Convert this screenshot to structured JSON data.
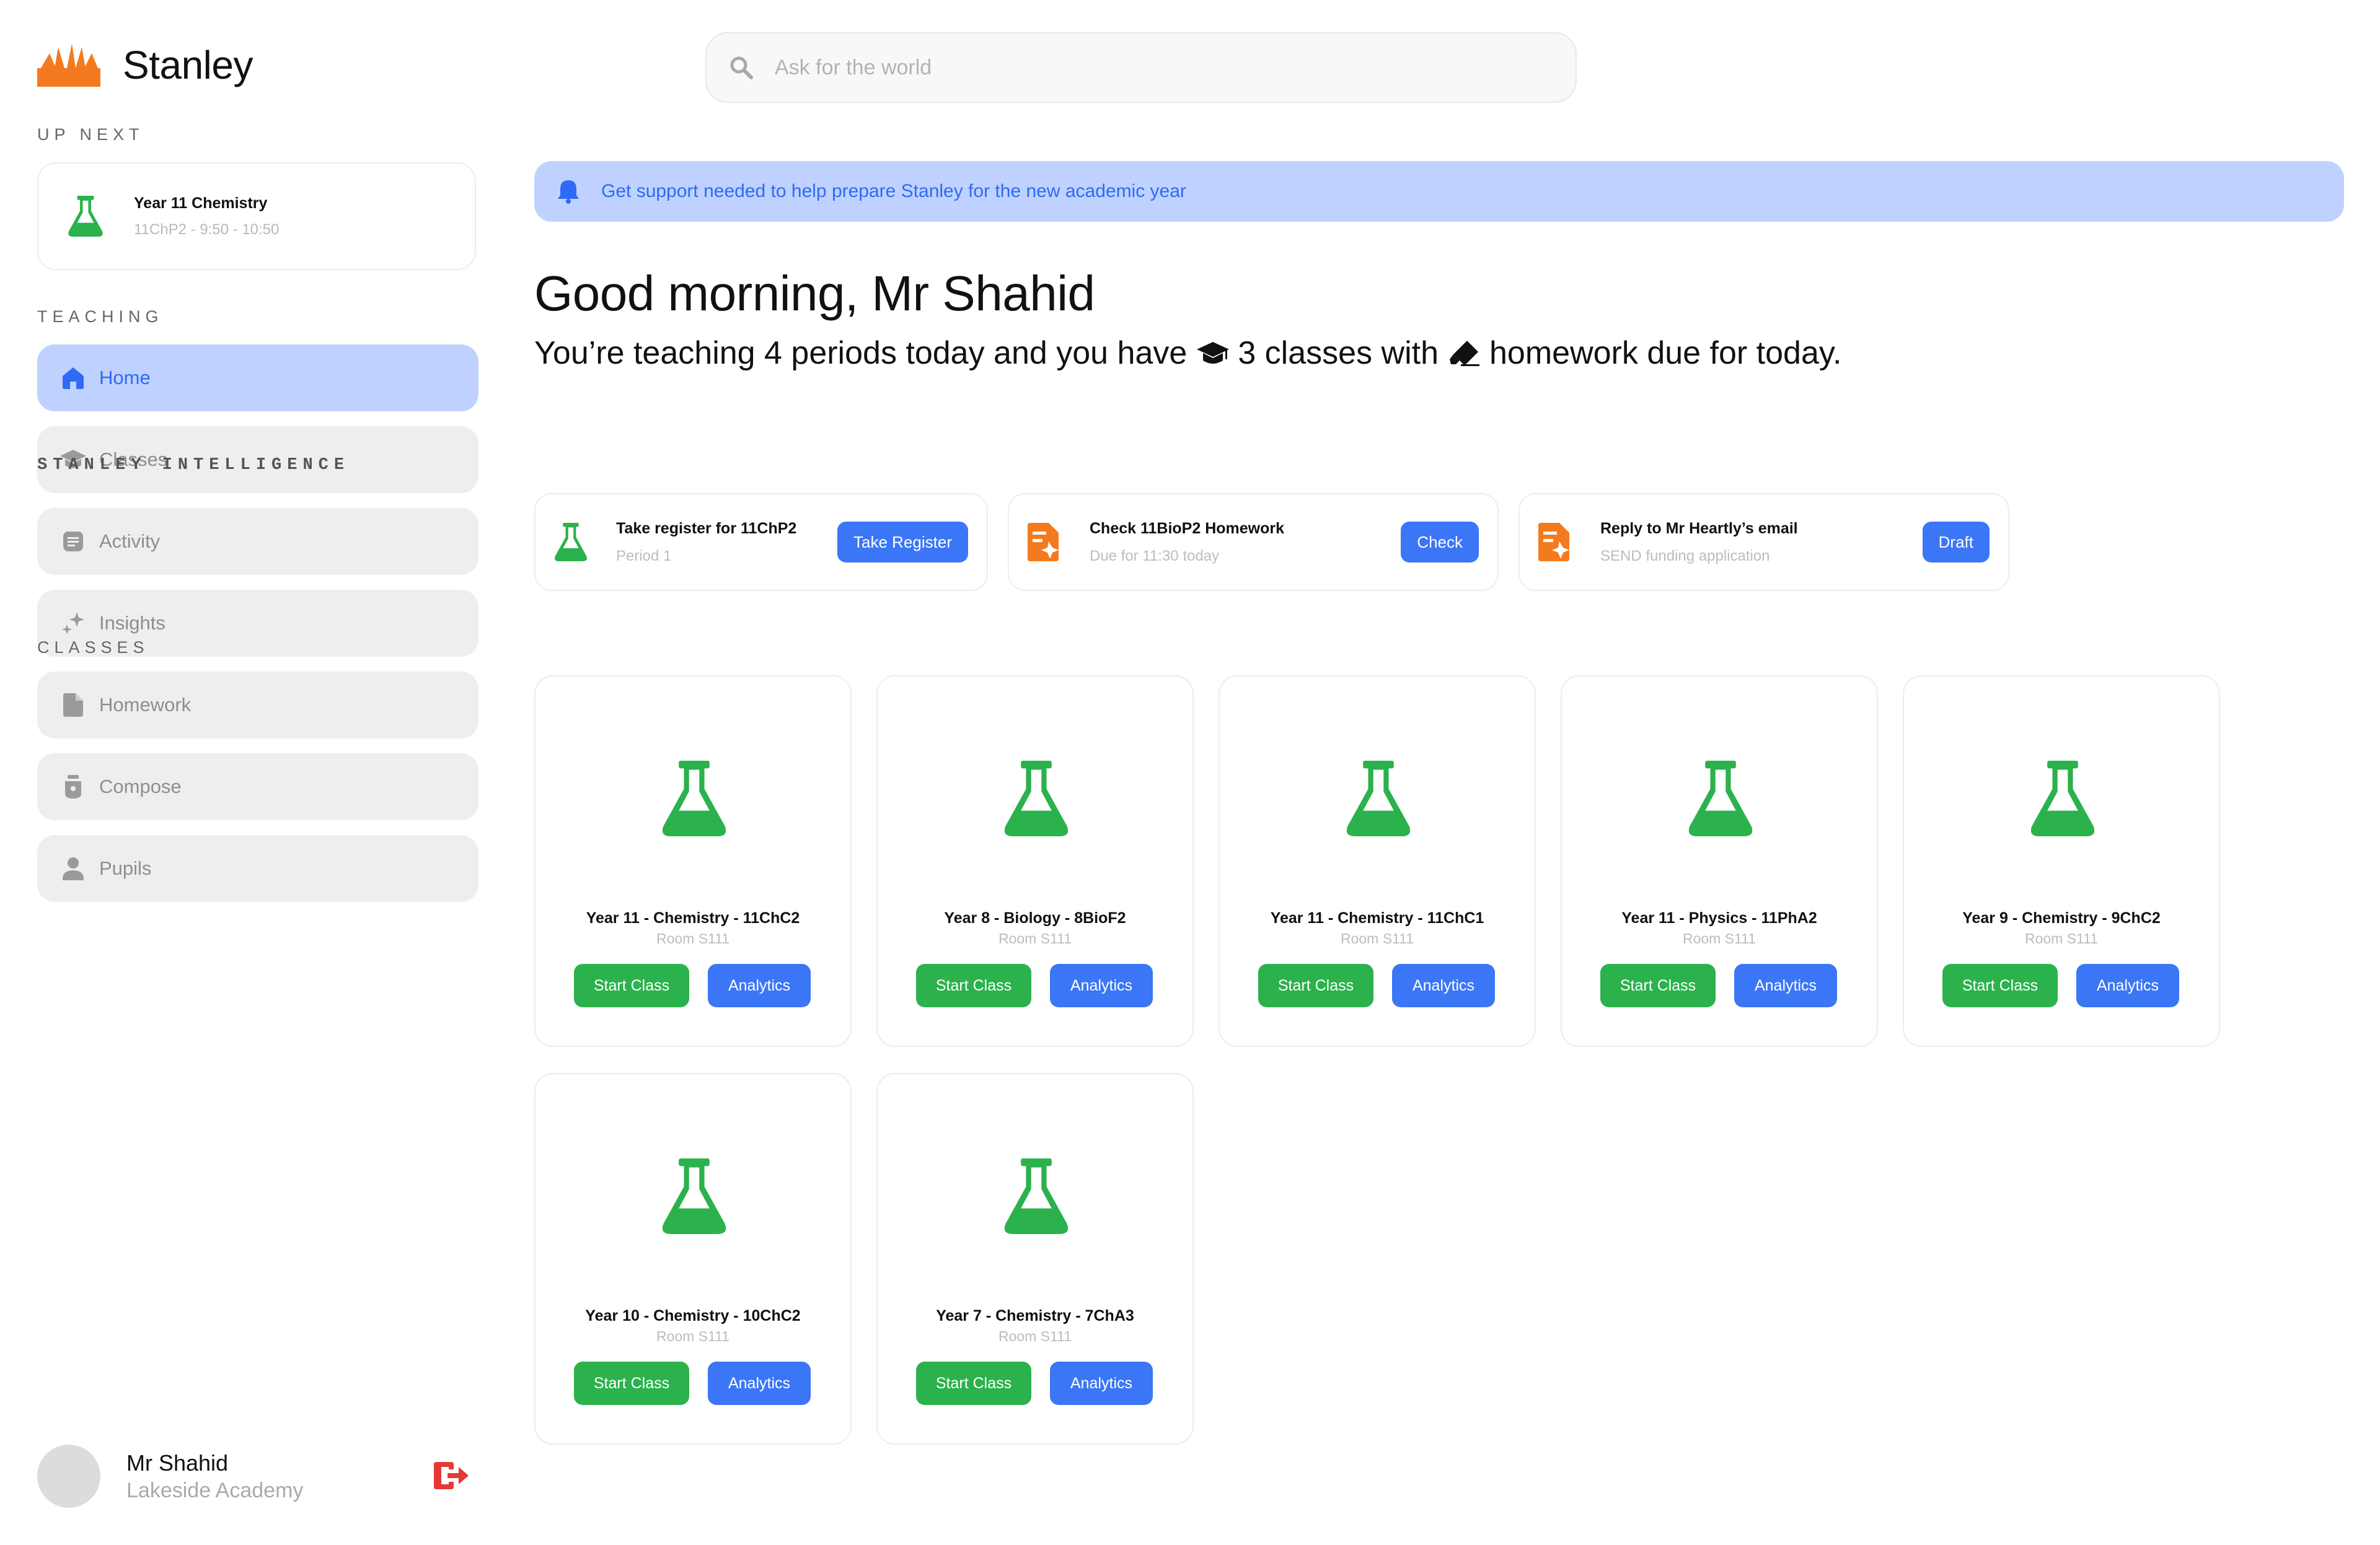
{
  "app": {
    "name": "Stanley"
  },
  "colors": {
    "accent": "#2f6af5",
    "active_bg": "#bfd2ff",
    "green": "#2bb24c",
    "orange": "#f47a1f",
    "red": "#e53935"
  },
  "up_next": {
    "label": "UP NEXT",
    "title": "Year 11 Chemistry",
    "detail": "11ChP2 - 9:50 - 10:50",
    "icon": "flask-icon"
  },
  "sidebar": {
    "section_label": "TEACHING",
    "items": [
      {
        "label": "Home",
        "icon": "home-icon",
        "active": true
      },
      {
        "label": "Classes",
        "icon": "graduation-cap-icon",
        "active": false
      },
      {
        "label": "Activity",
        "icon": "list-icon",
        "active": false
      },
      {
        "label": "Insights",
        "icon": "sparkle-icon",
        "active": false
      },
      {
        "label": "Homework",
        "icon": "document-icon",
        "active": false
      },
      {
        "label": "Compose",
        "icon": "pen-nib-icon",
        "active": false
      },
      {
        "label": "Pupils",
        "icon": "person-icon",
        "active": false
      }
    ]
  },
  "profile": {
    "name": "Mr Shahid",
    "school": "Lakeside Academy"
  },
  "search": {
    "placeholder": "Ask for the world"
  },
  "banner": {
    "text": "Get support needed to help prepare Stanley for the new academic year"
  },
  "greeting": {
    "title": "Good morning, Mr Shahid",
    "part1": "You’re teaching 4 periods today and you have",
    "part2": "3 classes with",
    "part3": "homework due for today."
  },
  "intelligence": {
    "label": "STANLEY INTELLIGENCE",
    "items": [
      {
        "title": "Take register for 11ChP2",
        "subtitle": "Period 1",
        "button": "Take Register",
        "icon": "flask-icon"
      },
      {
        "title": "Check 11BioP2 Homework",
        "subtitle": "Due for 11:30 today",
        "button": "Check",
        "icon": "homework-doc-icon"
      },
      {
        "title": "Reply to Mr Heartly’s email",
        "subtitle": "SEND funding application",
        "button": "Draft",
        "icon": "homework-doc-icon"
      }
    ]
  },
  "classes": {
    "label": "CLASSES",
    "start_label": "Start Class",
    "analytics_label": "Analytics",
    "items": [
      {
        "title": "Year 11 - Chemistry - 11ChC2",
        "room": "Room S111"
      },
      {
        "title": "Year 8 - Biology - 8BioF2",
        "room": "Room S111"
      },
      {
        "title": "Year 11 - Chemistry - 11ChC1",
        "room": "Room S111"
      },
      {
        "title": "Year 11 - Physics - 11PhA2",
        "room": "Room S111"
      },
      {
        "title": "Year 9 - Chemistry - 9ChC2",
        "room": "Room S111"
      },
      {
        "title": "Year 10 - Chemistry - 10ChC2",
        "room": "Room S111"
      },
      {
        "title": "Year 7 - Chemistry - 7ChA3",
        "room": "Room S111"
      }
    ]
  }
}
